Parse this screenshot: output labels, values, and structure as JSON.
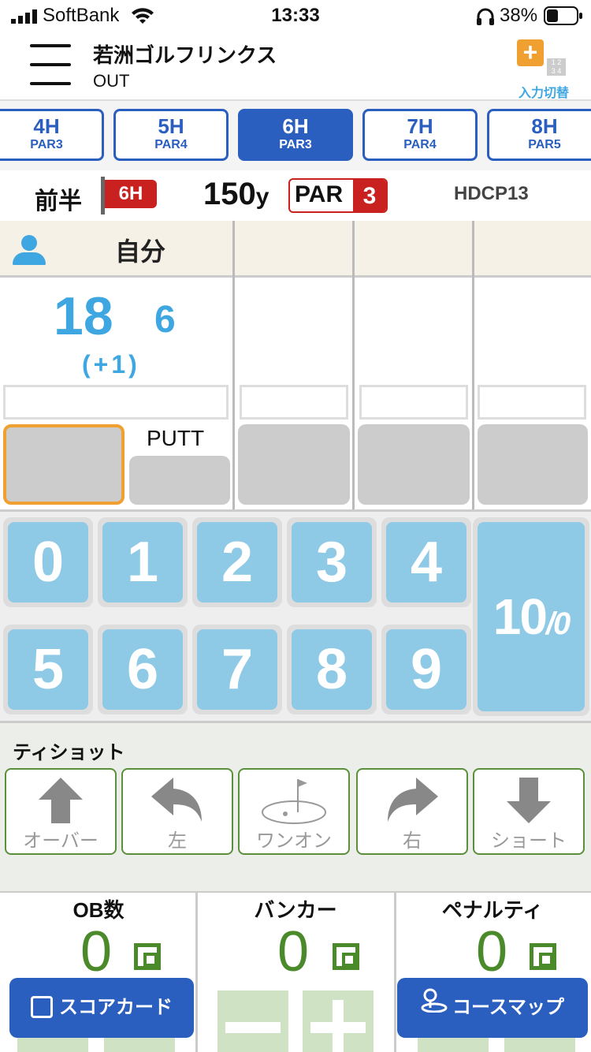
{
  "status": {
    "carrier": "SoftBank",
    "time": "13:33",
    "battery": "38%"
  },
  "header": {
    "course": "若洲ゴルフリンクス",
    "half": "OUT",
    "switch_label": "入力切替",
    "switch_nums": "1 2\n3 4"
  },
  "tabs": [
    {
      "hole": "4H",
      "par": "PAR3"
    },
    {
      "hole": "5H",
      "par": "PAR4"
    },
    {
      "hole": "6H",
      "par": "PAR3",
      "active": true
    },
    {
      "hole": "7H",
      "par": "PAR4"
    },
    {
      "hole": "8H",
      "par": "PAR5"
    }
  ],
  "hole": {
    "half": "前半",
    "flag": "6H",
    "yards": "150",
    "yard_unit": "y",
    "par_label": "PAR",
    "par": "3",
    "hdcp": "HDCP13"
  },
  "player": {
    "name": "自分",
    "total": "18",
    "strokes": "6",
    "diff": "(+1)",
    "putt_label": "PUTT"
  },
  "keypad": {
    "keys": [
      "0",
      "1",
      "2",
      "3",
      "4",
      "5",
      "6",
      "7",
      "8",
      "9"
    ],
    "ten": "10",
    "ten_sub": "/0"
  },
  "tee_shot": {
    "label": "ティショット",
    "options": [
      "オーバー",
      "左",
      "ワンオン",
      "右",
      "ショート"
    ]
  },
  "stats": [
    {
      "label": "OB数",
      "value": "0"
    },
    {
      "label": "バンカー",
      "value": "0"
    },
    {
      "label": "ペナルティ",
      "value": "0"
    }
  ],
  "bottom": {
    "scorecard": "スコアカード",
    "coursemap": "コースマップ"
  },
  "colors": {
    "accent": "#2a5fbf",
    "score": "#3ea6e0",
    "key": "#8ecae6",
    "flag": "#c8211f",
    "selected": "#f0a030",
    "green": "#4a8a2a"
  }
}
